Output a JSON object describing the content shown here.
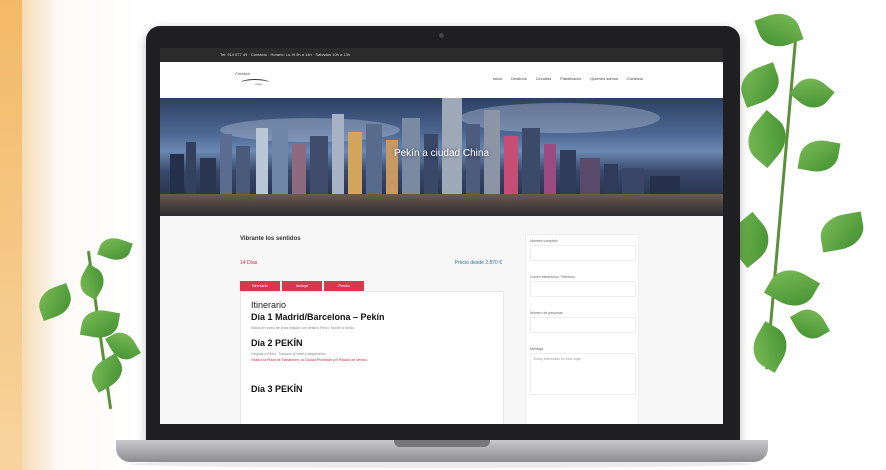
{
  "site": {
    "topbar_text": "Tel: 914 577 49 · Contacto · Horario: Lu-Vi 9h a 14h · Sábados 10h a 13h",
    "logo_text": "Chinatur",
    "logo_subtext": "viajes",
    "nav": [
      "Inicio",
      "Destinos",
      "Circuitos",
      "Planificador",
      "Quiénes somos",
      "Contacto"
    ],
    "hero_title": "Pekín a ciudad China",
    "page_heading": "Vibrante los sentidos",
    "days_label": "14 Días",
    "price_label": "Precio desde 2.870 €",
    "tabs": [
      "Itinerario",
      "Incluye",
      "Precio"
    ],
    "itinerary_label": "Itinerario",
    "days": [
      {
        "title": "Día 1 Madrid/Barcelona – Pekín",
        "desc": "Salida en vuelo de línea regular con destino Pekín. Noche a bordo.",
        "desc2": ""
      },
      {
        "title": "Día 2 PEKÍN",
        "desc": "Llegada a Pekín. Traslado al hotel y alojamiento.",
        "desc2": "Visita a la Plaza de Tiananmen, la Ciudad Prohibida y el Palacio de Verano."
      },
      {
        "title": "Día 3 PEKÍN",
        "desc": "",
        "desc2": ""
      }
    ],
    "form": {
      "fields": [
        "Nombre completo",
        "Correo electrónico / Teléfono",
        "Número de personas",
        "Mensaje"
      ],
      "message_placeholder": "Estoy interesado en este viaje"
    }
  }
}
